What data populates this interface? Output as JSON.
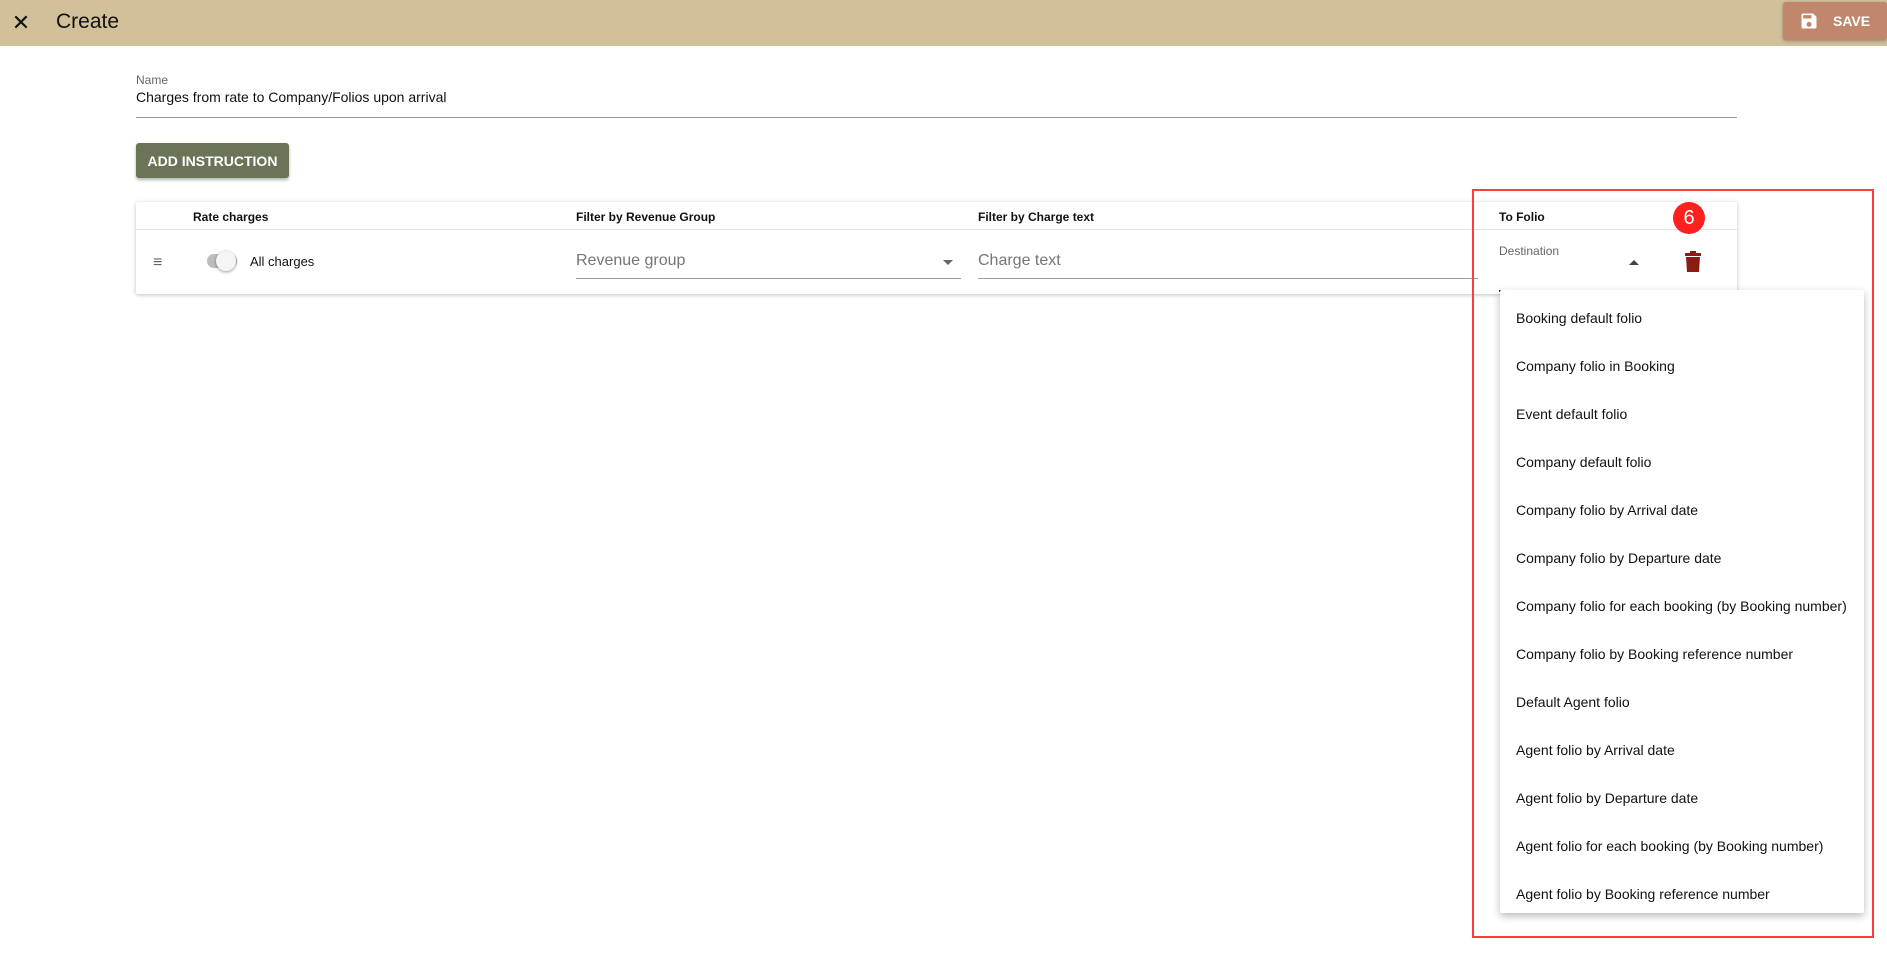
{
  "header": {
    "title": "Create",
    "save_label": "SAVE",
    "colors": {
      "bar": "#d1c09a",
      "save": "#c0876c"
    }
  },
  "form": {
    "name_label": "Name",
    "name_value": "Charges from rate to Company/Folios upon arrival",
    "add_instruction_label": "ADD INSTRUCTION"
  },
  "table": {
    "columns": [
      "Rate charges",
      "Filter by Revenue Group",
      "Filter by Charge text",
      "To Folio"
    ],
    "row": {
      "toggle_label": "All charges",
      "revenue_placeholder": "Revenue group",
      "charge_placeholder": "Charge text",
      "destination_label": "Destination"
    }
  },
  "annotation": {
    "step": "6",
    "color": "#ff2020"
  },
  "dropdown": {
    "options": [
      "Booking default folio",
      "Company folio in Booking",
      "Event default folio",
      "Company default folio",
      "Company folio by Arrival date",
      "Company folio by Departure date",
      "Company folio for each booking (by Booking number)",
      "Company folio by Booking reference number",
      "Default Agent folio",
      "Agent folio by Arrival date",
      "Agent folio by Departure date",
      "Agent folio for each booking (by Booking number)",
      "Agent folio by Booking reference number"
    ]
  }
}
